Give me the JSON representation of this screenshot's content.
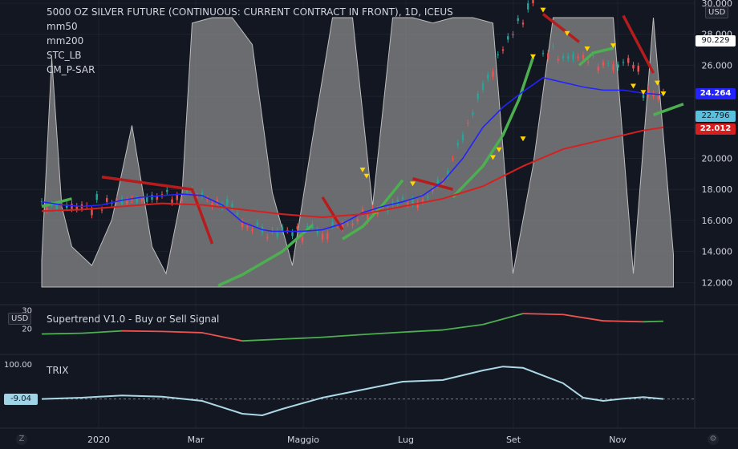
{
  "legend": {
    "title": "5000 OZ SILVER FUTURE (CONTINUOUS: CURRENT CONTRACT IN FRONT), 1D, ICEUS",
    "indicators": [
      "mm50",
      "mm200",
      "STC_LB",
      "CM_P-SAR"
    ]
  },
  "currency": "USD",
  "badges": {
    "stc": "90.229",
    "price": "24.264",
    "mm50": "22.796",
    "mm200": "22.012",
    "trix": "-9.04"
  },
  "colors": {
    "background": "#131722",
    "up": "#26a69a",
    "down": "#ef5350",
    "mm50": "#2323ff",
    "mm200": "#d62020",
    "sar_bull": "#4caf50",
    "sar_bear": "#b71c1c",
    "stc": "#8a8a8a",
    "trix": "#add8e6",
    "arrow": "#ffd600"
  },
  "supertrend": {
    "title": "Supertrend V1.0 - Buy or Sell Signal",
    "ticks": [
      "30",
      "20"
    ]
  },
  "trix": {
    "title": "TRIX",
    "ticks": [
      "100.00"
    ]
  },
  "xaxis": [
    "2020",
    "Mar",
    "Maggio",
    "Lug",
    "Set",
    "Nov"
  ],
  "zoom_buttons": [
    "Z",
    "⚙"
  ],
  "chart_data": [
    {
      "type": "line",
      "pane": "price",
      "yticks": [
        "30.000",
        "28.000",
        "26.000",
        "24.000",
        "22.000",
        "20.000",
        "18.000",
        "16.000",
        "14.000",
        "12.000"
      ],
      "ylim": [
        11.5,
        30
      ],
      "series": [
        {
          "name": "mm50",
          "x": [
            0,
            10,
            20,
            30,
            40,
            50,
            60,
            70,
            80,
            90,
            100,
            110,
            115,
            120,
            130,
            140,
            150,
            160,
            170,
            180,
            190,
            200,
            210,
            220,
            230,
            240,
            250,
            260,
            270,
            280,
            290,
            300,
            310
          ],
          "y": [
            17.2,
            17.0,
            16.9,
            17.0,
            17.3,
            17.5,
            17.6,
            17.7,
            17.6,
            17.0,
            15.9,
            15.4,
            15.3,
            15.3,
            15.3,
            15.4,
            15.8,
            16.5,
            16.9,
            17.2,
            17.6,
            18.5,
            20.0,
            22.0,
            23.3,
            24.3,
            25.2,
            24.9,
            24.6,
            24.4,
            24.4,
            24.2,
            24.1
          ]
        },
        {
          "name": "mm200",
          "x": [
            0,
            20,
            40,
            60,
            80,
            100,
            120,
            140,
            160,
            180,
            200,
            220,
            240,
            260,
            280,
            300,
            310
          ],
          "y": [
            16.6,
            16.7,
            16.9,
            17.1,
            17.0,
            16.7,
            16.4,
            16.2,
            16.4,
            16.9,
            17.4,
            18.2,
            19.5,
            20.6,
            21.2,
            21.8,
            22.0
          ]
        },
        {
          "name": "CM_P-SAR",
          "segments": [
            {
              "dir": "bull",
              "x": [
                0,
                15
              ],
              "y": [
                16.9,
                17.4
              ]
            },
            {
              "dir": "bear",
              "x": [
                30,
                75,
                85
              ],
              "y": [
                18.8,
                18.0,
                14.5
              ]
            },
            {
              "dir": "bull",
              "x": [
                88,
                100,
                120,
                135
              ],
              "y": [
                11.8,
                12.5,
                14.0,
                15.7
              ]
            },
            {
              "dir": "bear",
              "x": [
                140,
                150
              ],
              "y": [
                17.5,
                15.4
              ]
            },
            {
              "dir": "bull",
              "x": [
                150,
                160,
                170,
                180
              ],
              "y": [
                14.8,
                15.6,
                17.0,
                18.6
              ]
            },
            {
              "dir": "bear",
              "x": [
                185,
                205
              ],
              "y": [
                18.7,
                18.0
              ]
            },
            {
              "dir": "bull",
              "x": [
                205,
                220,
                230,
                238,
                245
              ],
              "y": [
                17.5,
                19.5,
                21.5,
                23.8,
                26.5
              ]
            },
            {
              "dir": "bear",
              "x": [
                250,
                268
              ],
              "y": [
                29.3,
                27.5
              ]
            },
            {
              "dir": "bull",
              "x": [
                268,
                275,
                285
              ],
              "y": [
                26.0,
                26.8,
                27.1
              ]
            },
            {
              "dir": "bear",
              "x": [
                290,
                305
              ],
              "y": [
                29.2,
                25.5
              ]
            },
            {
              "dir": "bull",
              "x": [
                305,
                320
              ],
              "y": [
                22.8,
                23.5
              ]
            }
          ]
        }
      ]
    },
    {
      "type": "area",
      "pane": "price",
      "name": "STC_LB",
      "range": [
        0,
        100
      ],
      "x": [
        0,
        5,
        10,
        15,
        25,
        35,
        45,
        55,
        62,
        70,
        75,
        85,
        95,
        105,
        115,
        125,
        135,
        145,
        155,
        165,
        175,
        185,
        195,
        205,
        215,
        225,
        235,
        245,
        255,
        265,
        275,
        285,
        295,
        305,
        315
      ],
      "y": [
        10,
        85,
        30,
        15,
        8,
        25,
        60,
        15,
        5,
        35,
        98,
        100,
        100,
        90,
        35,
        8,
        55,
        100,
        100,
        30,
        100,
        100,
        98,
        100,
        100,
        98,
        5,
        45,
        100,
        100,
        100,
        100,
        5,
        100,
        12
      ]
    },
    {
      "type": "line",
      "pane": "supertrend",
      "name": "Supertrend",
      "x": [
        0,
        20,
        40,
        60,
        80,
        100,
        120,
        140,
        160,
        180,
        200,
        220,
        240,
        260,
        280,
        300,
        310
      ],
      "y": [
        16.8,
        17.2,
        18.5,
        18.2,
        17.5,
        13.0,
        14.0,
        15.0,
        16.5,
        17.8,
        19.0,
        22.0,
        28.0,
        27.5,
        24.0,
        23.5,
        23.8
      ]
    },
    {
      "type": "line",
      "pane": "trix",
      "name": "TRIX",
      "zero": 0,
      "x": [
        0,
        20,
        40,
        60,
        80,
        100,
        110,
        120,
        140,
        160,
        180,
        200,
        220,
        230,
        240,
        260,
        270,
        280,
        290,
        300,
        310
      ],
      "y": [
        -9,
        -5,
        2,
        -2,
        -15,
        -55,
        -60,
        -40,
        -5,
        20,
        45,
        50,
        80,
        92,
        88,
        40,
        -5,
        -15,
        -8,
        -3,
        -9
      ]
    }
  ]
}
